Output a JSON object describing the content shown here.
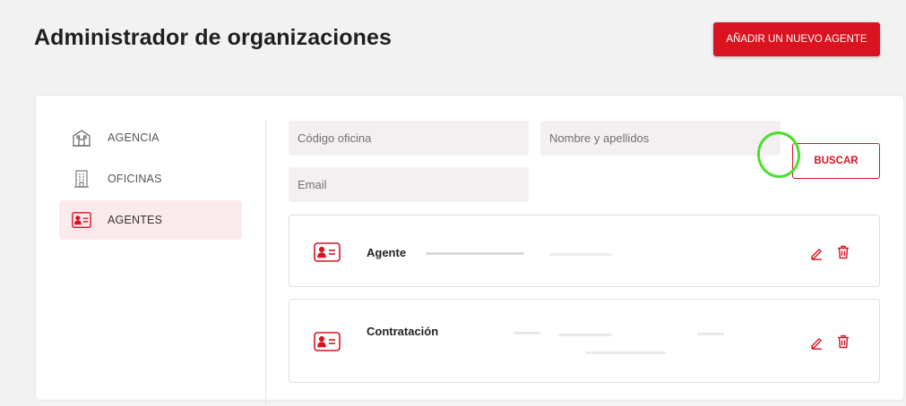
{
  "header": {
    "title": "Administrador de organizaciones",
    "add_button": "AÑADIR UN NUEVO AGENTE"
  },
  "sidebar": {
    "items": [
      {
        "label": "AGENCIA",
        "icon": "building-icon",
        "active": false
      },
      {
        "label": "OFICINAS",
        "icon": "office-icon",
        "active": false
      },
      {
        "label": "AGENTES",
        "icon": "id-card-icon",
        "active": true
      }
    ]
  },
  "filters": {
    "office_code_placeholder": "Código oficina",
    "name_placeholder": "Nombre y apellidos",
    "email_placeholder": "Email",
    "search_button": "BUSCAR"
  },
  "results": [
    {
      "title": "Agente",
      "actions": [
        "edit-icon",
        "trash-icon"
      ]
    },
    {
      "title": "Contratación",
      "actions": [
        "edit-icon",
        "trash-icon"
      ]
    }
  ],
  "colors": {
    "accent": "#d9131f",
    "active_bg": "#fbeaec",
    "field_bg": "#f4f0f1",
    "highlight": "#47e02a"
  }
}
